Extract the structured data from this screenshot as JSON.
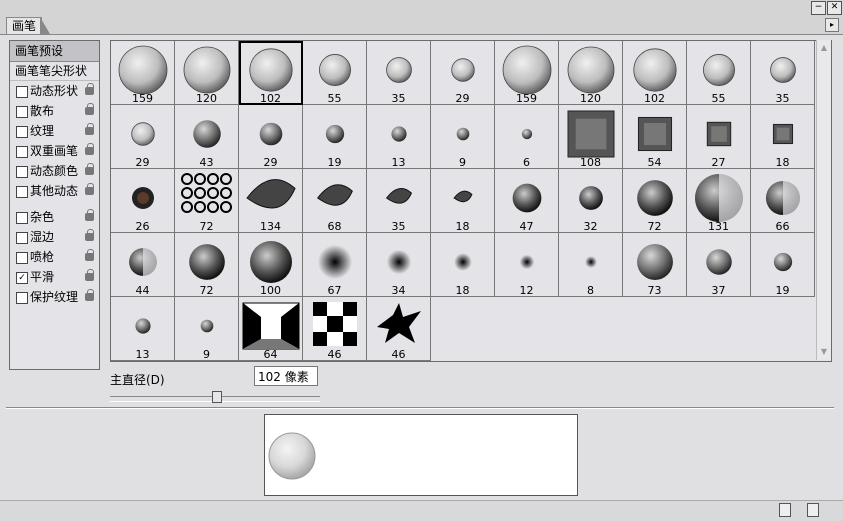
{
  "panel": {
    "tab_label": "画笔"
  },
  "left_panel": {
    "header": "画笔预设",
    "subheader": "画笔笔尖形状",
    "options_group1": [
      {
        "label": "动态形状",
        "checked": false
      },
      {
        "label": "散布",
        "checked": false
      },
      {
        "label": "纹理",
        "checked": false
      },
      {
        "label": "双重画笔",
        "checked": false
      },
      {
        "label": "动态颜色",
        "checked": false
      },
      {
        "label": "其他动态",
        "checked": false
      }
    ],
    "options_group2": [
      {
        "label": "杂色",
        "checked": false
      },
      {
        "label": "湿边",
        "checked": false
      },
      {
        "label": "喷枪",
        "checked": false
      },
      {
        "label": "平滑",
        "checked": true
      },
      {
        "label": "保护纹理",
        "checked": false
      }
    ]
  },
  "brushes": {
    "selected_index": 2,
    "items": [
      {
        "size": "159",
        "kind": "hard-sphere"
      },
      {
        "size": "120",
        "kind": "hard-sphere"
      },
      {
        "size": "102",
        "kind": "hard-sphere"
      },
      {
        "size": "55",
        "kind": "soft-sphere"
      },
      {
        "size": "35",
        "kind": "soft-sphere"
      },
      {
        "size": "29",
        "kind": "soft-sphere"
      },
      {
        "size": "159",
        "kind": "hard-sphere"
      },
      {
        "size": "120",
        "kind": "hard-sphere"
      },
      {
        "size": "102",
        "kind": "hard-sphere"
      },
      {
        "size": "55",
        "kind": "soft-sphere"
      },
      {
        "size": "35",
        "kind": "soft-sphere"
      },
      {
        "size": "29",
        "kind": "soft-sphere"
      },
      {
        "size": "43",
        "kind": "dark-sphere"
      },
      {
        "size": "29",
        "kind": "dark-sphere"
      },
      {
        "size": "19",
        "kind": "dark-sphere"
      },
      {
        "size": "13",
        "kind": "dark-sphere"
      },
      {
        "size": "9",
        "kind": "dark-sphere"
      },
      {
        "size": "6",
        "kind": "dark-sphere"
      },
      {
        "size": "108",
        "kind": "texture"
      },
      {
        "size": "54",
        "kind": "texture"
      },
      {
        "size": "27",
        "kind": "texture"
      },
      {
        "size": "18",
        "kind": "texture"
      },
      {
        "size": "26",
        "kind": "blot"
      },
      {
        "size": "72",
        "kind": "rings"
      },
      {
        "size": "134",
        "kind": "leaf"
      },
      {
        "size": "68",
        "kind": "leaf"
      },
      {
        "size": "35",
        "kind": "leaf"
      },
      {
        "size": "18",
        "kind": "leaf"
      },
      {
        "size": "47",
        "kind": "planet"
      },
      {
        "size": "32",
        "kind": "planet"
      },
      {
        "size": "72",
        "kind": "planet"
      },
      {
        "size": "131",
        "kind": "half-planet"
      },
      {
        "size": "66",
        "kind": "half-planet"
      },
      {
        "size": "44",
        "kind": "half-planet"
      },
      {
        "size": "72",
        "kind": "planet"
      },
      {
        "size": "100",
        "kind": "planet"
      },
      {
        "size": "67",
        "kind": "soft-dot"
      },
      {
        "size": "34",
        "kind": "soft-dot"
      },
      {
        "size": "18",
        "kind": "soft-dot"
      },
      {
        "size": "12",
        "kind": "soft-dot"
      },
      {
        "size": "8",
        "kind": "soft-dot"
      },
      {
        "size": "73",
        "kind": "dark-sphere"
      },
      {
        "size": "37",
        "kind": "dark-sphere"
      },
      {
        "size": "19",
        "kind": "dark-sphere"
      },
      {
        "size": "13",
        "kind": "dark-sphere"
      },
      {
        "size": "9",
        "kind": "dark-sphere"
      },
      {
        "size": "64",
        "kind": "room"
      },
      {
        "size": "46",
        "kind": "checker"
      },
      {
        "size": "46",
        "kind": "bird"
      }
    ]
  },
  "diameter": {
    "label": "主直径(D)",
    "value": "102 像素",
    "slider_fraction": 0.5
  },
  "window_buttons": {
    "minimize": "−",
    "close": "✕"
  },
  "menu_arrow": "▸"
}
